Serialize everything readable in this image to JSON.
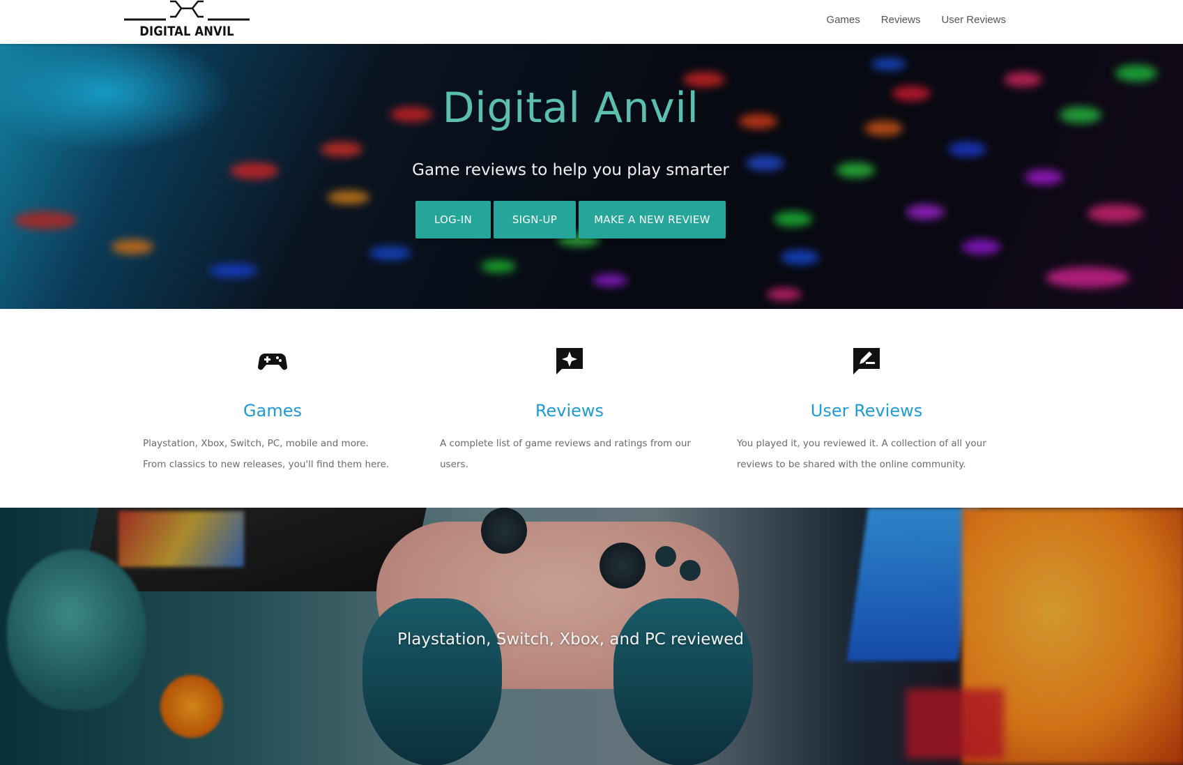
{
  "brand": {
    "name": "DIGITAL ANVIL",
    "logo_icon": "anvil-icon"
  },
  "nav": {
    "items": [
      {
        "label": "Games"
      },
      {
        "label": "Reviews"
      },
      {
        "label": "User Reviews"
      }
    ]
  },
  "hero": {
    "title": "Digital Anvil",
    "subtitle": "Game reviews to help you play smarter",
    "buttons": {
      "login": "LOG-IN",
      "signup": "SIGN-UP",
      "new_review": "MAKE A NEW REVIEW"
    },
    "button_color": "#26a69a",
    "title_color": "#5bbfb0"
  },
  "features": [
    {
      "icon": "gamepad-icon",
      "title": "Games",
      "description": "Playstation, Xbox, Switch, PC, mobile and more. From classics to new releases, you'll find them here."
    },
    {
      "icon": "review-star-icon",
      "title": "Reviews",
      "description": "A complete list of game reviews and ratings from our users."
    },
    {
      "icon": "rate-review-icon",
      "title": "User Reviews",
      "description": "You played it, you reviewed it. A collection of all your reviews to be shared with the online community."
    }
  ],
  "feature_title_color": "#1e9bd7",
  "parallax": {
    "caption": "Playstation, Switch, Xbox, and PC reviewed"
  }
}
